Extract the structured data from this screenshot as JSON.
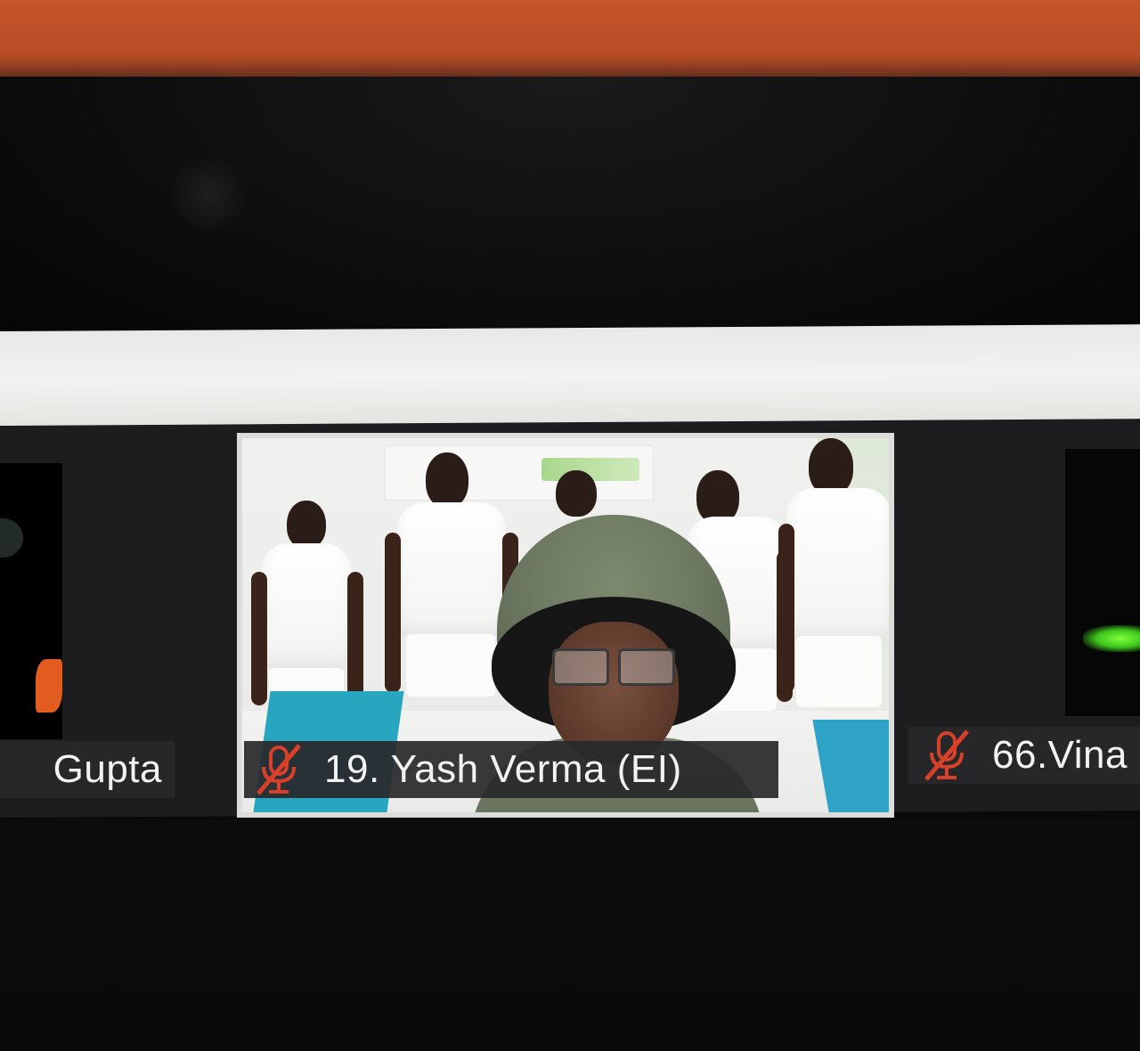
{
  "gallery": {
    "participants": [
      {
        "name": "Gupta",
        "muted": false,
        "position": "partial-left"
      },
      {
        "name": "19. Yash Verma (EI)",
        "muted": true,
        "active": true
      },
      {
        "name": "66.Vina",
        "muted": true,
        "position": "partial-right"
      }
    ]
  },
  "icons": {
    "muted": "mic-muted-icon"
  },
  "colors": {
    "muted_icon": "#d8402a",
    "name_bar_bg": "#28282a",
    "name_text": "#f2f2f2",
    "header_bg": "#ececea"
  }
}
